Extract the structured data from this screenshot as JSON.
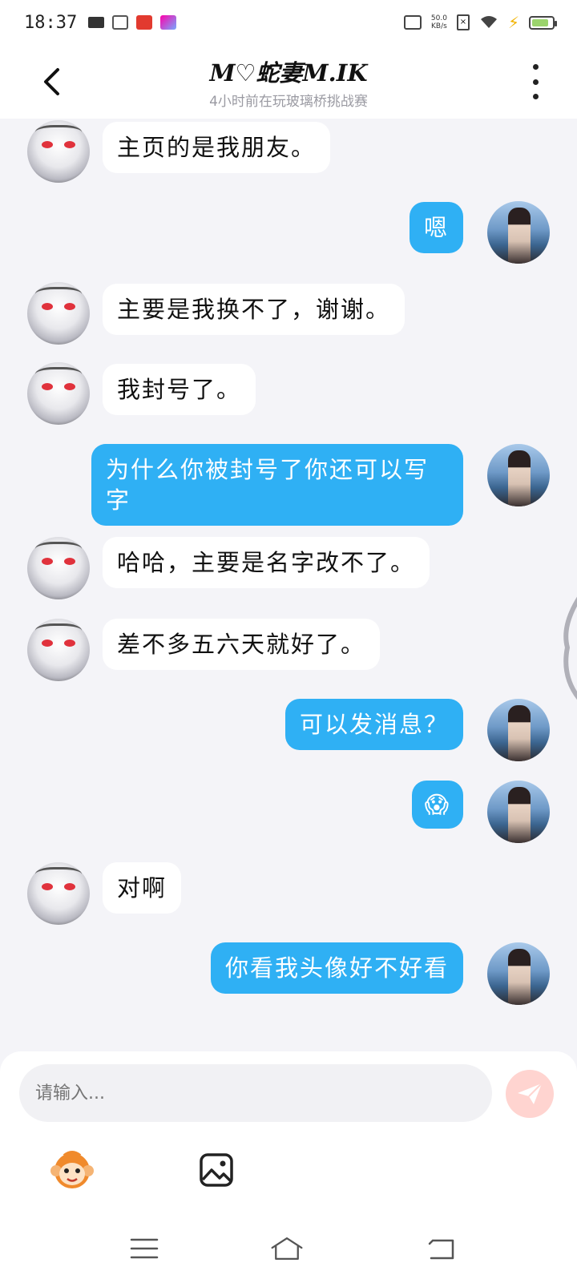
{
  "status_bar": {
    "time": "18:37",
    "net_speed_value": "50.0",
    "net_speed_unit": "KB/s"
  },
  "header": {
    "title": "M♡蛇妻M.IK",
    "subtitle": "4小时前在玩玻璃桥挑战赛"
  },
  "messages": [
    {
      "from": "other",
      "text": "主页的是我朋友。"
    },
    {
      "from": "self",
      "text": "嗯"
    },
    {
      "from": "other",
      "text": "主要是我换不了，谢谢。"
    },
    {
      "from": "other",
      "text": "我封号了。"
    },
    {
      "from": "self",
      "text": "为什么你被封号了你还可以写字"
    },
    {
      "from": "other",
      "text": "哈哈，主要是名字改不了。"
    },
    {
      "from": "other",
      "text": "差不多五六天就好了。"
    },
    {
      "from": "self",
      "text": "可以发消息？"
    },
    {
      "from": "self",
      "text": "😱"
    },
    {
      "from": "other",
      "text": "对啊"
    },
    {
      "from": "self",
      "text": "你看我头像好不好看"
    }
  ],
  "input": {
    "placeholder": "请输入..."
  },
  "colors": {
    "self_bubble": "#2fb0f4",
    "other_bubble": "#ffffff",
    "background": "#f4f4f8",
    "send_button": "#ffd4d0"
  },
  "icons": {
    "back": "chevron-left-icon",
    "more": "more-vertical-icon",
    "send": "send-icon",
    "emoji": "monkey-emoji-icon",
    "image": "image-icon"
  }
}
